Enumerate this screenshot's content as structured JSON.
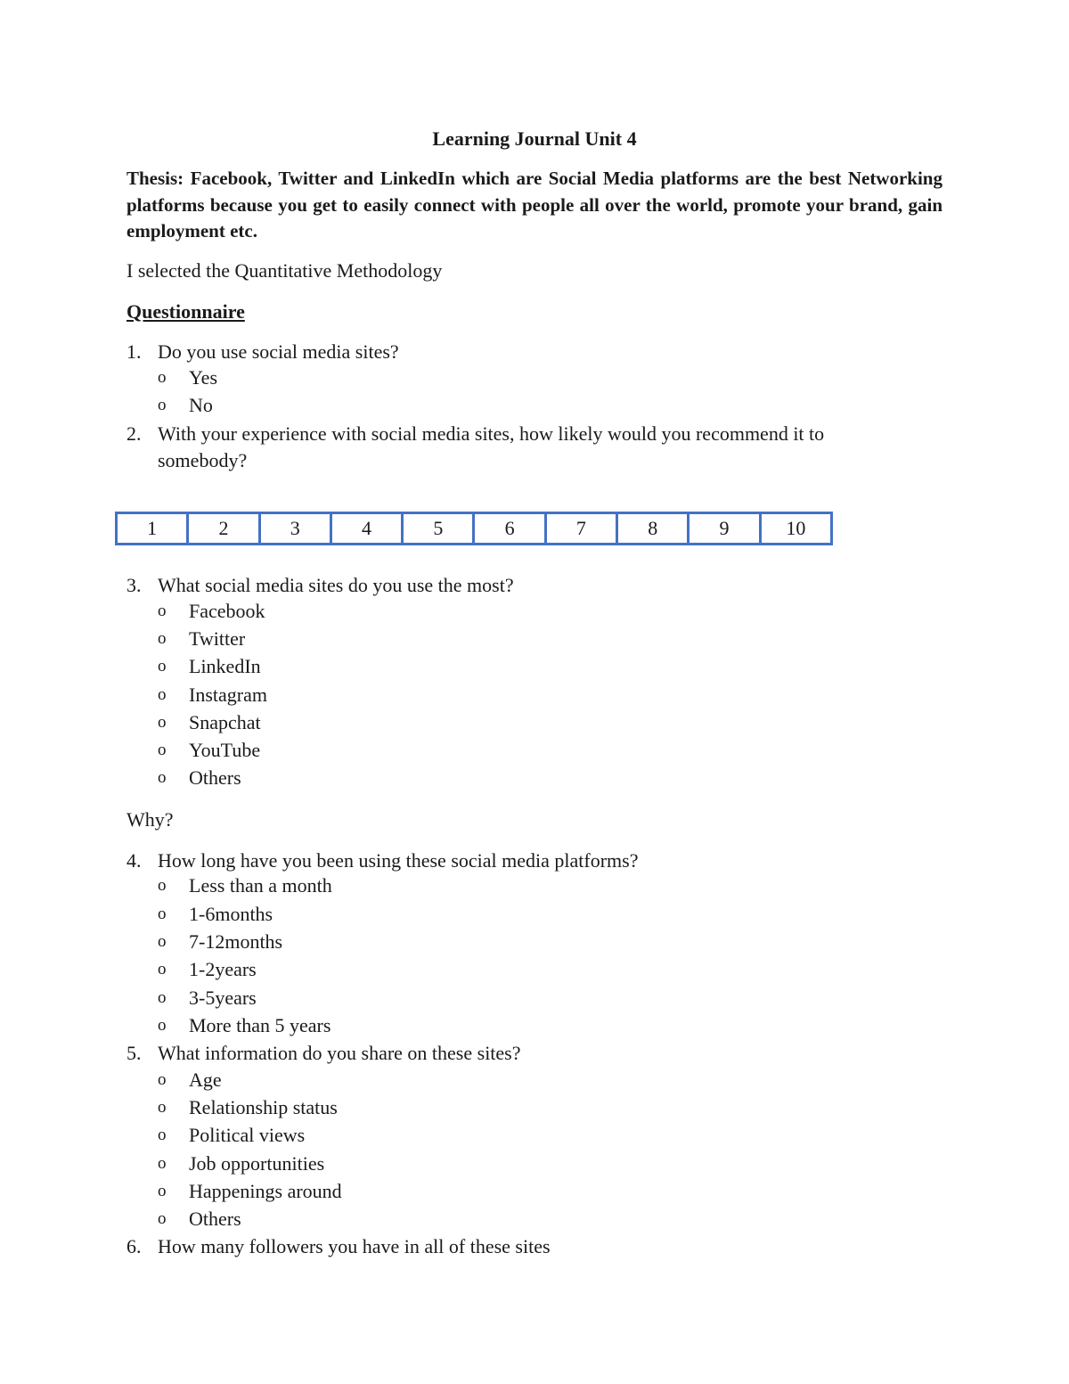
{
  "document": {
    "title": "Learning Journal Unit 4",
    "thesis": "Thesis:  Facebook, Twitter and LinkedIn which are Social Media platforms are the best Networking platforms because you get to easily connect with people all over the world, promote your brand, gain employment etc.",
    "methodology": "I selected the Quantitative Methodology",
    "section_heading": "Questionnaire",
    "why_label": "Why?",
    "bullet_glyph": "o",
    "scale_border_color": "#4472c4",
    "questions": [
      {
        "number": "1.",
        "text": "Do you use social media sites?",
        "options": [
          "Yes",
          "No"
        ]
      },
      {
        "number": "2.",
        "text_line1": "With your experience with social media sites, how likely would you recommend it to",
        "text_line2": "somebody?",
        "scale": [
          "1",
          "2",
          "3",
          "4",
          "5",
          "6",
          "7",
          "8",
          "9",
          "10"
        ]
      },
      {
        "number": "3.",
        "text": "What social media sites do you use the most?",
        "options": [
          "Facebook",
          "Twitter",
          "LinkedIn",
          "Instagram",
          "Snapchat",
          "YouTube",
          "Others"
        ]
      },
      {
        "number": "4.",
        "text": "How long have you been using these social media platforms?",
        "options": [
          "Less than a month",
          "1-6months",
          "7-12months",
          "1-2years",
          "3-5years",
          "More than 5 years"
        ]
      },
      {
        "number": "5.",
        "text": "What information do you share on these sites?",
        "options": [
          "Age",
          "Relationship status",
          "Political views",
          "Job opportunities",
          "Happenings around",
          "Others"
        ]
      },
      {
        "number": "6.",
        "text": "How many followers you have in all of these sites"
      }
    ]
  }
}
